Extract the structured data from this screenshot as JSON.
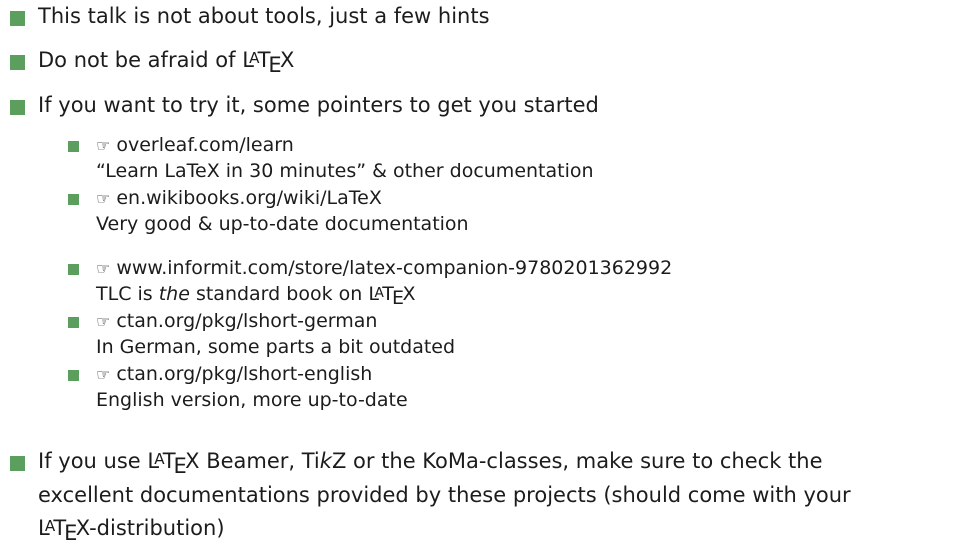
{
  "bullet_color": "#5b9e5e",
  "hand_icon": "☞",
  "items": [
    {
      "text": "This talk is not about tools, just a few hints"
    },
    {
      "pre": "Do not be afraid of ",
      "post": ""
    },
    {
      "text": "If you want to try it, some pointers to get you started"
    }
  ],
  "latex": {
    "L": "L",
    "A": "A",
    "T": "T",
    "E": "E",
    "X": "X"
  },
  "pointers": [
    {
      "link": "overleaf.com/learn",
      "desc": "“Learn LaTeX in 30 minutes” & other documentation"
    },
    {
      "link": "en.wikibooks.org/wiki/LaTeX",
      "desc": "Very good & up-to-date documentation"
    },
    {
      "link": "www.informit.com/store/latex-companion-9780201362992",
      "desc_pre": "TLC is ",
      "desc_em": "the",
      "desc_mid": " standard book on "
    },
    {
      "link": "ctan.org/pkg/lshort-german",
      "desc": "In German, some parts a bit outdated"
    },
    {
      "link": "ctan.org/pkg/lshort-english",
      "desc": "English version, more up-to-date"
    }
  ],
  "final": {
    "line1_pre": "If you use ",
    "line1_mid": " Beamer, Ti",
    "line1_em": "k",
    "line1_post": "Z or the KoMa-classes, make sure to check the",
    "line2": "excellent documentations provided by these projects (should come with your",
    "line3_post": "-distribution)"
  }
}
